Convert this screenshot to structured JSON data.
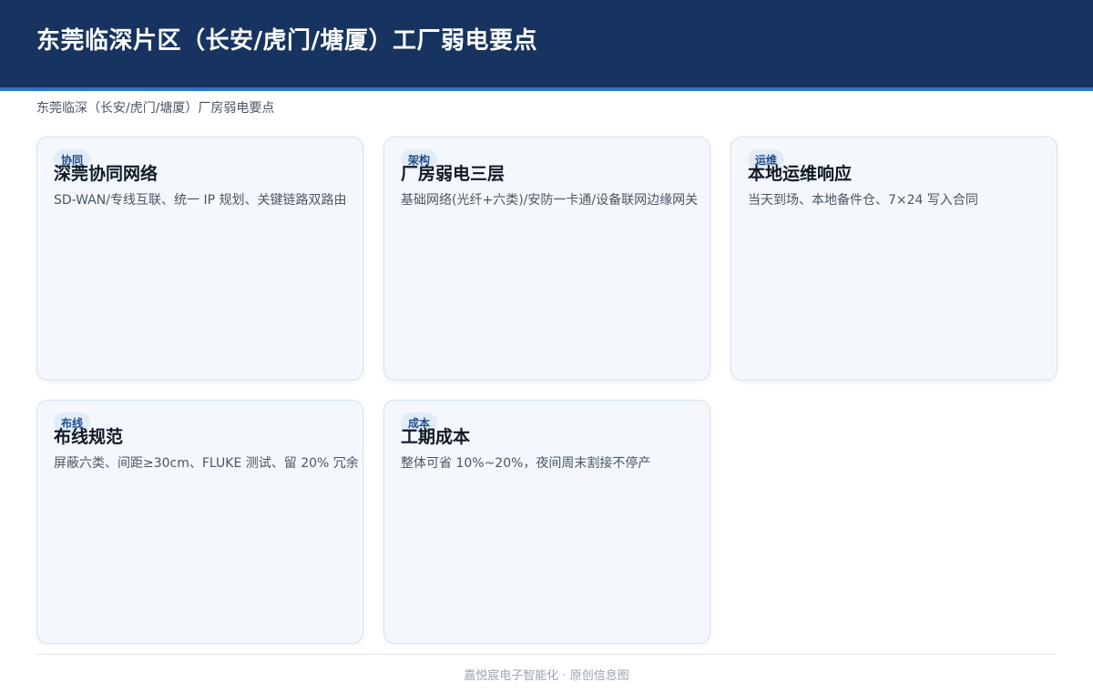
{
  "header": {
    "title": "东莞临深片区（长安/虎门/塘厦）工厂弱电要点"
  },
  "subtitle": "东莞临深（长安/虎门/塘厦）厂房弱电要点",
  "cards": [
    {
      "tag": "协同",
      "title": "深莞协同网络",
      "desc": "SD-WAN/专线互联、统一 IP 规划、关键链路双路由"
    },
    {
      "tag": "架构",
      "title": "厂房弱电三层",
      "desc": "基础网络(光纤+六类)/安防一卡通/设备联网边缘网关"
    },
    {
      "tag": "运维",
      "title": "本地运维响应",
      "desc": "当天到场、本地备件仓、7×24 写入合同"
    },
    {
      "tag": "布线",
      "title": "布线规范",
      "desc": "屏蔽六类、间距≥30cm、FLUKE 测试、留 20% 冗余"
    },
    {
      "tag": "成本",
      "title": "工期成本",
      "desc": "整体可省 10%~20%，夜间周末割接不停产"
    }
  ],
  "footer": "嘉悦宸电子智能化 · 原创信息图",
  "colors": {
    "header_bg": "#17335f",
    "header_accent": "#2f73c9",
    "card_bg": "#f4f8fc",
    "card_border": "#d5e1ee",
    "tag_bg": "#e2ecf8",
    "tag_text": "#1f4e8c"
  }
}
